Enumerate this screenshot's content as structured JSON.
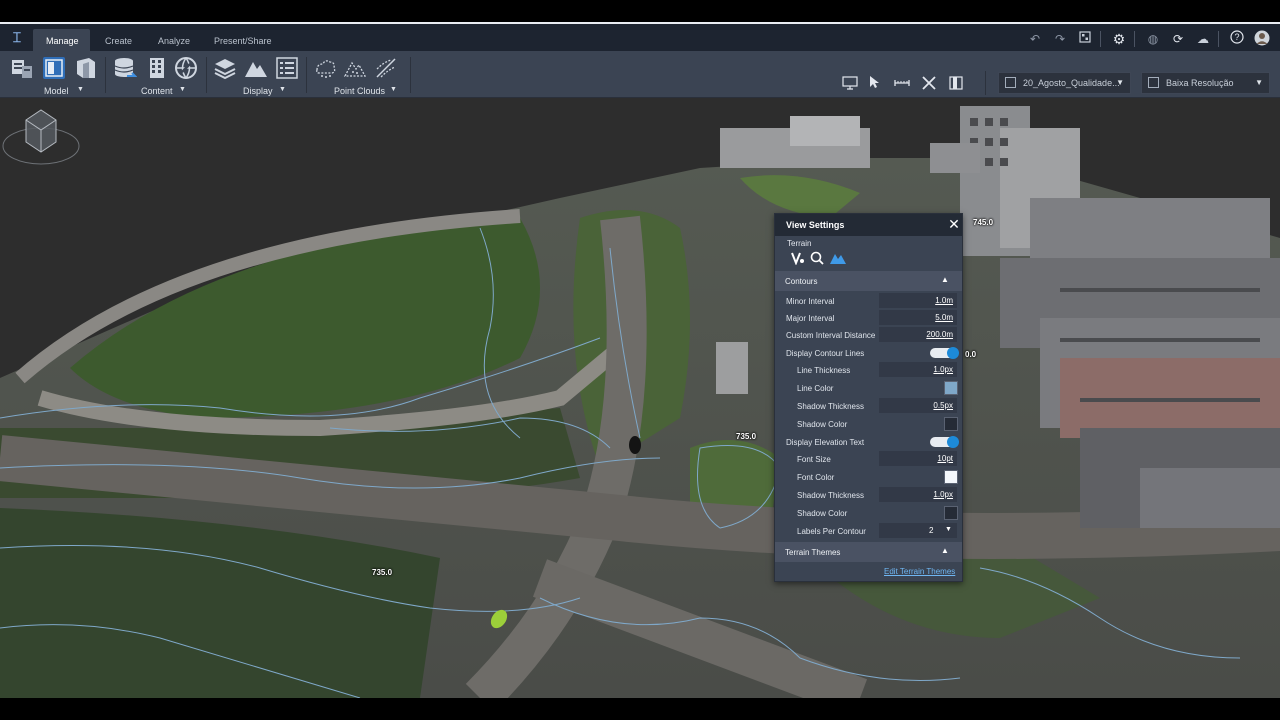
{
  "tabs": [
    {
      "label": "Manage",
      "active": true
    },
    {
      "label": "Create",
      "active": false
    },
    {
      "label": "Analyze",
      "active": false
    },
    {
      "label": "Present/Share",
      "active": false
    }
  ],
  "ribbon": {
    "groups": [
      {
        "label": "Model",
        "icons": [
          "model-explorer-icon",
          "model-layout-icon",
          "model-map-icon"
        ]
      },
      {
        "label": "Content",
        "icons": [
          "data-sources-icon",
          "city-furniture-icon",
          "globe-icon"
        ]
      },
      {
        "label": "Display",
        "icons": [
          "layers-icon",
          "terrain-icon",
          "style-list-icon"
        ]
      },
      {
        "label": "Point Clouds",
        "icons": [
          "point-cloud-icon",
          "point-cloud-surface-icon",
          "point-cloud-edit-icon"
        ]
      }
    ],
    "model_dropdown": "20_Agosto_Qualidade...",
    "resolution_dropdown": "Baixa Resolução"
  },
  "viewport": {
    "elevation_labels": [
      "745.0",
      "735.0",
      "735.0",
      "0.0"
    ]
  },
  "view_settings": {
    "title": "View Settings",
    "terrain_label": "Terrain",
    "contours": {
      "label": "Contours",
      "minor_interval_label": "Minor Interval",
      "minor_interval": "1.0m",
      "major_interval_label": "Major Interval",
      "major_interval": "5.0m",
      "custom_interval_label": "Custom Interval Distance",
      "custom_interval": "200.0m",
      "display_lines_label": "Display Contour Lines",
      "display_lines_on": true,
      "line_thickness_label": "Line Thickness",
      "line_thickness": "1.0px",
      "line_color_label": "Line Color",
      "line_color": "#7fa8c9",
      "shadow_thickness_label": "Shadow Thickness",
      "shadow_thickness": "0.5px",
      "shadow_color_label": "Shadow Color",
      "shadow_color": "#252b36",
      "display_elevation_label": "Display Elevation Text",
      "display_elevation_on": true,
      "font_size_label": "Font Size",
      "font_size": "10pt",
      "font_color_label": "Font Color",
      "font_color": "#f4f8fc",
      "text_shadow_thickness_label": "Shadow Thickness",
      "text_shadow_thickness": "1.0px",
      "text_shadow_color_label": "Shadow Color",
      "text_shadow_color": "#252b36",
      "labels_per_contour_label": "Labels Per Contour",
      "labels_per_contour": "2"
    },
    "terrain_themes_label": "Terrain Themes",
    "edit_terrain_themes": "Edit Terrain Themes"
  },
  "colors": {
    "accent": "#1d8ad8",
    "ribbon_bg": "#3b4453",
    "tabbar_bg": "#1d2430",
    "link": "#6fb6f2"
  }
}
